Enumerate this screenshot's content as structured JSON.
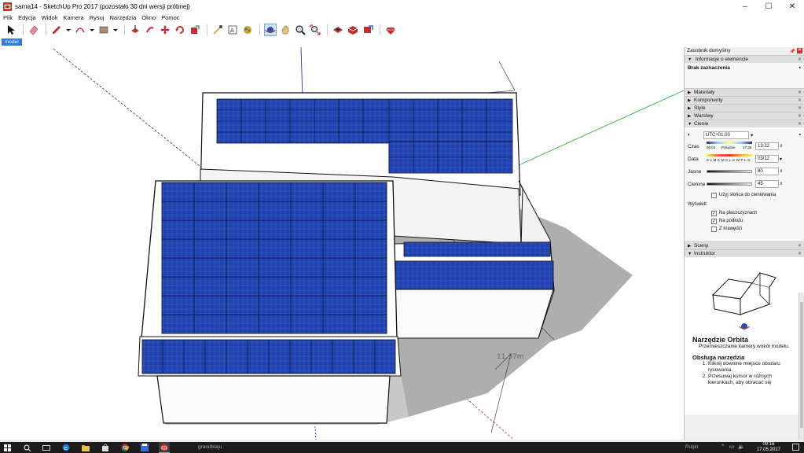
{
  "window": {
    "title": "sarna14 - SketchUp Pro 2017 (pozostało 30 dni wersji próbnej)",
    "minimize": "–",
    "maximize": "☐",
    "close": "✕"
  },
  "menu": [
    "Plik",
    "Edycja",
    "Widok",
    "Kamera",
    "Rysuj",
    "Narzędzia",
    "Okno",
    "Pomoc"
  ],
  "scene_tab": "model",
  "viewport": {
    "dimension_1": "11,37m",
    "dimension_2": "m"
  },
  "tray": {
    "title": "Zasobnik domyślny",
    "entity_info": {
      "header": "Informacje o elemencie",
      "value": "Brak zaznaczenia"
    },
    "panels": [
      "Materiały",
      "Komponenty",
      "Style",
      "Warstwy"
    ],
    "shadows": {
      "header": "Cienie",
      "timezone": "UTC+01:00",
      "time_label": "Czas",
      "time_start": "06:04",
      "time_mid": "Południe",
      "time_end": "17:36",
      "time_value": "13:22",
      "date_label": "Data",
      "months": "S L M K M C L S W P L G",
      "date_value": "03/12",
      "light_label": "Jasne",
      "light_value": "80",
      "dark_label": "Ciemne",
      "dark_value": "45",
      "use_sun": "Użyj słońca do cieniowania",
      "display_label": "Wyświetl:",
      "on_faces": "Na płaszczyznach",
      "on_ground": "Na podłożu",
      "from_edges": "Z krawędzi"
    },
    "scenes": "Sceny",
    "instructor": {
      "header": "Instruktor",
      "tool_title": "Narzędzie Orbita",
      "tool_desc": "Przemieszczanie kamery wokół modelu.",
      "usage_title": "Obsługa narzędzia",
      "steps": [
        "Kliknij dowolne miejsce obszaru rysowania.",
        "Przesuwaj kursor w różnych kierunkach, aby obracać się"
      ]
    }
  },
  "taskbar": {
    "status_text": "grandblaju",
    "right_text": "Pulpit",
    "time": "09:16",
    "date": "17.05.2017"
  },
  "colors": {
    "panel": "#1f3fa6",
    "panel_light": "#3a5fd0",
    "accent": "#2b7bd8",
    "axis_green": "#2fb82f",
    "axis_blue": "#3030c8",
    "axis_red": "#c83030"
  }
}
